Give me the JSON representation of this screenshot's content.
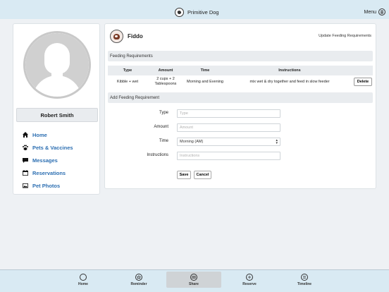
{
  "topbar": {
    "brand": "Primitive Dog",
    "menu_label": "Menu"
  },
  "profile": {
    "name": "Robert Smith",
    "nav": [
      {
        "label": "Home",
        "icon": "home-icon"
      },
      {
        "label": "Pets & Vaccines",
        "icon": "paw-icon"
      },
      {
        "label": "Messages",
        "icon": "messages-icon"
      },
      {
        "label": "Reservations",
        "icon": "calendar-icon"
      },
      {
        "label": "Pet Photos",
        "icon": "photos-icon"
      }
    ]
  },
  "pet": {
    "name": "Fiddo",
    "update_link": "Update Feeding Requirements"
  },
  "feeding": {
    "section_title": "Feeding Requirements",
    "columns": [
      "Type",
      "Amount",
      "Time",
      "Instructions"
    ],
    "rows": [
      {
        "type": "Kibble + wet",
        "amount": "2 cups + 2 Tablespoons",
        "time": "Morning and Evening",
        "instructions": "mix wet & dry together and feed in slow feeder",
        "action": "Delete"
      }
    ]
  },
  "add_form": {
    "section_title": "Add Feeding Requirement",
    "type_label": "Type",
    "type_placeholder": "Type",
    "amount_label": "Amount",
    "amount_placeholder": "Amount",
    "time_label": "Time",
    "time_value": "Morning (AM)",
    "instructions_label": "Instructions",
    "instructions_placeholder": "Instructions",
    "save_label": "Save",
    "cancel_label": "Cancel"
  },
  "tabs": [
    {
      "label": "Home",
      "icon": "home-circle-icon",
      "active": false
    },
    {
      "label": "Reminder",
      "icon": "reminder-icon",
      "active": false
    },
    {
      "label": "Share",
      "icon": "share-icon",
      "active": true
    },
    {
      "label": "Reserve",
      "icon": "plus-icon",
      "active": false
    },
    {
      "label": "Timeline",
      "icon": "timeline-icon",
      "active": false
    }
  ]
}
